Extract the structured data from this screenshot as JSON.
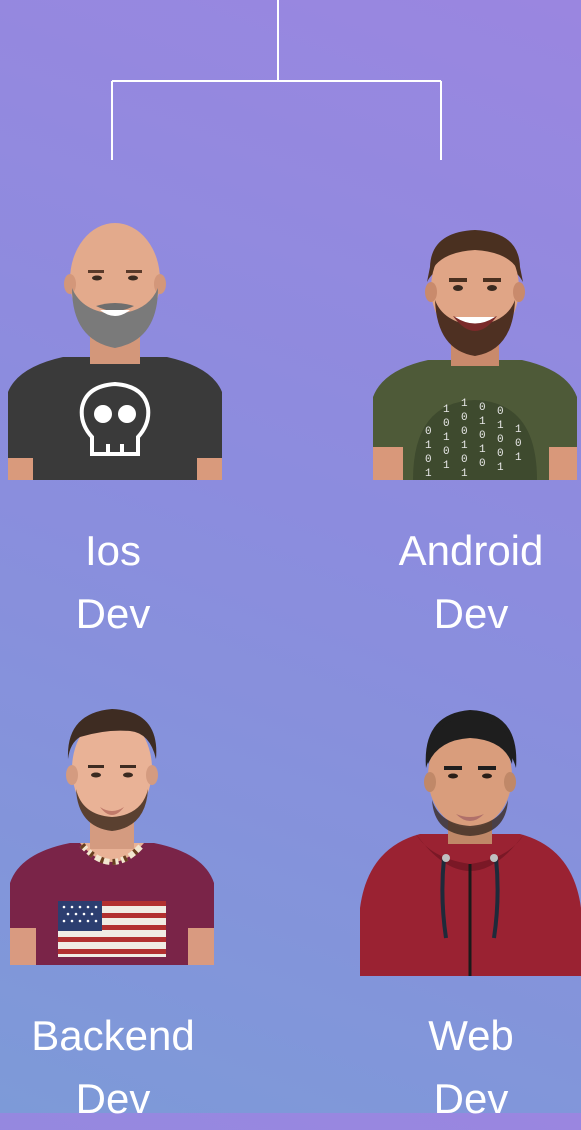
{
  "team": [
    {
      "line1": "Ios",
      "line2": "Dev",
      "avatar": "bald-bearded-man-skull-shirt"
    },
    {
      "line1": "Android",
      "line2": "Dev",
      "avatar": "smiling-man-binary-shirt"
    },
    {
      "line1": "Backend",
      "line2": "Dev",
      "avatar": "man-necklace-flag-shirt"
    },
    {
      "line1": "Web",
      "line2": "Dev",
      "avatar": "man-red-hoodie"
    }
  ],
  "colors": {
    "line": "#ffffff",
    "text": "#ffffff",
    "bg_top": "#9a86e0",
    "bg_bottom": "#7d9ad8"
  }
}
